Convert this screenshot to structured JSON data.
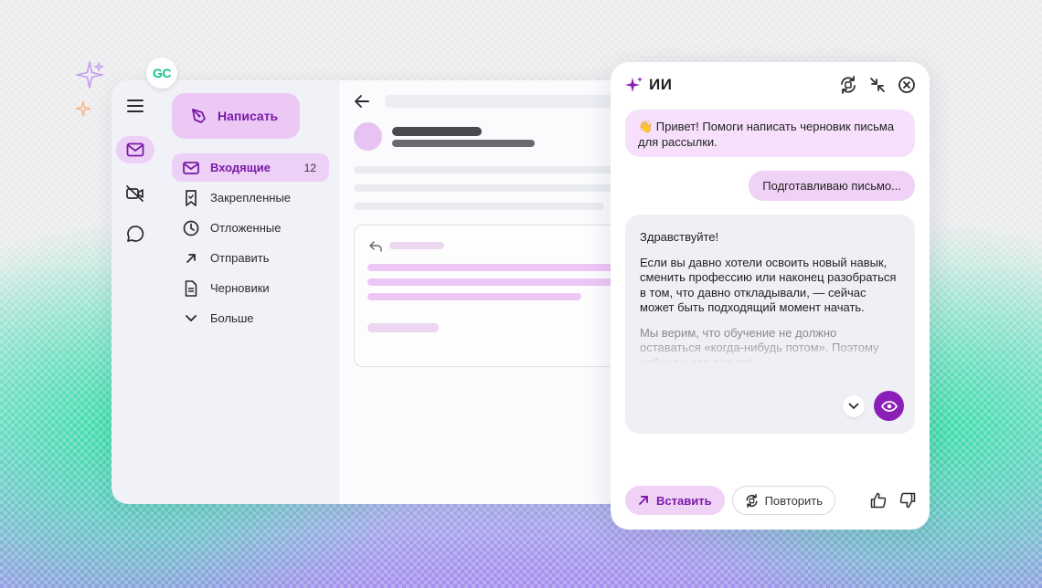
{
  "badge": {
    "label": "GC"
  },
  "mail": {
    "compose_label": "Написать",
    "folders": [
      {
        "label": "Входящие",
        "count": "12",
        "icon": "mail-icon",
        "active": true
      },
      {
        "label": "Закрепленные",
        "icon": "pin-bookmark-icon"
      },
      {
        "label": "Отложенные",
        "icon": "clock-icon"
      },
      {
        "label": "Отправить",
        "icon": "arrow-up-right-icon"
      },
      {
        "label": "Черновики",
        "icon": "document-icon"
      },
      {
        "label": "Больше",
        "icon": "chevron-down-icon"
      }
    ],
    "rail_icons": [
      "menu-icon",
      "mail-icon",
      "video-off-icon",
      "chat-icon"
    ]
  },
  "ai": {
    "title": "ИИ",
    "user_message": "👋 Привет! Помоги написать черновик письма для рассылки.",
    "status_message": "Подготавливаю письмо...",
    "reply": {
      "greeting": "Здравствуйте!",
      "paragraph1": "Если вы давно хотели освоить новый навык, сменить профессию или наконец разобраться в том, что давно откладывали, — сейчас может быть подходящий момент начать.",
      "paragraph2": "Мы верим, что обучение не должно оставаться «когда-нибудь потом». Поэтому собрали для вас всё"
    },
    "insert_label": "Вставить",
    "repeat_label": "Повторить"
  },
  "colors": {
    "accent": "#8a1fb8",
    "accent_soft": "#f0d2f7",
    "brand_green": "#14c48c"
  }
}
